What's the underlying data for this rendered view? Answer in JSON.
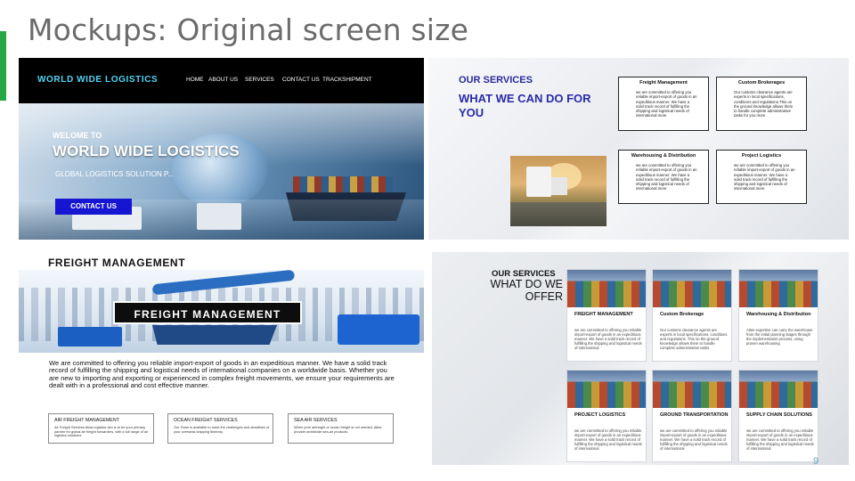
{
  "slide": {
    "title": "Mockups: Original screen size",
    "page_number": "9"
  },
  "panel1": {
    "logo": "WORLD WIDE LOGISTICS",
    "nav": [
      "HOME",
      "ABOUT US",
      "SERVICES",
      "CONTACT US",
      "TRACKSHIPMENT"
    ],
    "welcome": "WELOME TO",
    "headline": "WORLD WIDE LOGISTICS",
    "subtitle": "GLOBAL LOGISTICS SOLUTION P...",
    "cta": "CONTACT US"
  },
  "panel2": {
    "kicker": "OUR SERVICES",
    "heading": "WHAT WE CAN DO FOR YOU",
    "boxes": [
      {
        "title": "Freight Management",
        "body": "we are committed to offering you reliable import-export of goods in an expeditious manner. We have a solid track record of fulfilling the shipping and logistical needs of international more"
      },
      {
        "title": "Custom Brokerages",
        "body": "Our customs clearance agents are experts in local specifications, conditions and regulations.This on the ground knowledge allows them to handle complete administrative tasks for you more"
      },
      {
        "title": "Warehousing & Distribution",
        "body": "we are committed to offering you reliable import-export of goods in an expeditious manner. We have a solid track record of fulfilling the shipping and logistical needs of international more"
      },
      {
        "title": "Project Logistics",
        "body": "we are committed to offering you reliable import-export of goods in an expeditious manner. We have a solid track record of fulfilling the shipping and logistical needs of international more"
      }
    ]
  },
  "panel3": {
    "title": "FREIGHT MANAGEMENT",
    "banner_text": "FREIGHT MANAGEMENT",
    "paragraph": "We are committed to offering you reliable import-export of goods in an expeditious manner. We have a solid track record of fulfilling the shipping and logistical needs of international companies on a worldwide basis. Whether you are new to importing and exporting or experienced in complex freight movements, we ensure your requirements are dealt with in a professional and cost effective manner.",
    "cards": [
      {
        "title": "AIR FREIGHT MANAGEMENT",
        "body": "Air Freight Services Atlas logistics aim is to be your primary partner for global air freight forwarders, with a full range of air logistics solutions."
      },
      {
        "title": "OCEAN FREIGHT SERVICES",
        "body": "Our Team is available to meet the challenges and deadlines of your overseas shipping itinerary."
      },
      {
        "title": "SEA AIR SERVICES",
        "body": "When pure airfreight or ocean freight is not needed, Atlas provide worldwide sea-air products."
      }
    ]
  },
  "panel4": {
    "kicker": "OUR SERVICES",
    "heading": "WHAT DO WE OFFER",
    "tiles": [
      {
        "title": "FREIGHT MANAGEMENT",
        "body": "we are committed to offering you reliable import-export of goods in an expeditious manner. We have a solid track record of fulfilling the shipping and logistical needs of international"
      },
      {
        "title": "Custom Brokerage",
        "body": "Our customs clearance agents are experts in local specifications, conditions and regulations. This on the-ground knowledge allows them to handle complete administration tasks"
      },
      {
        "title": "Warehousing & Distribution",
        "body": "Atlas expertise can carry the warehouse from the initial planning stages through the implementation process, using proven warehousing"
      },
      {
        "title": "PROJECT LOGISTICS",
        "body": "we are committed to offering you reliable import-export of goods in an expeditious manner. We have a solid track record of fulfilling the shipping and logistical needs of international"
      },
      {
        "title": "GROUND TRANSPORTATION",
        "body": "we are committed to offering you reliable import-export of goods in an expeditious manner. We have a solid track record of fulfilling the shipping and logistical needs of international"
      },
      {
        "title": "SUPPLY CHAIN SOLUTIONS",
        "body": "we are committed to offering you reliable import-export of goods in an expeditious manner. We have a solid track record of fulfilling the shipping and logistical needs of international"
      }
    ]
  }
}
